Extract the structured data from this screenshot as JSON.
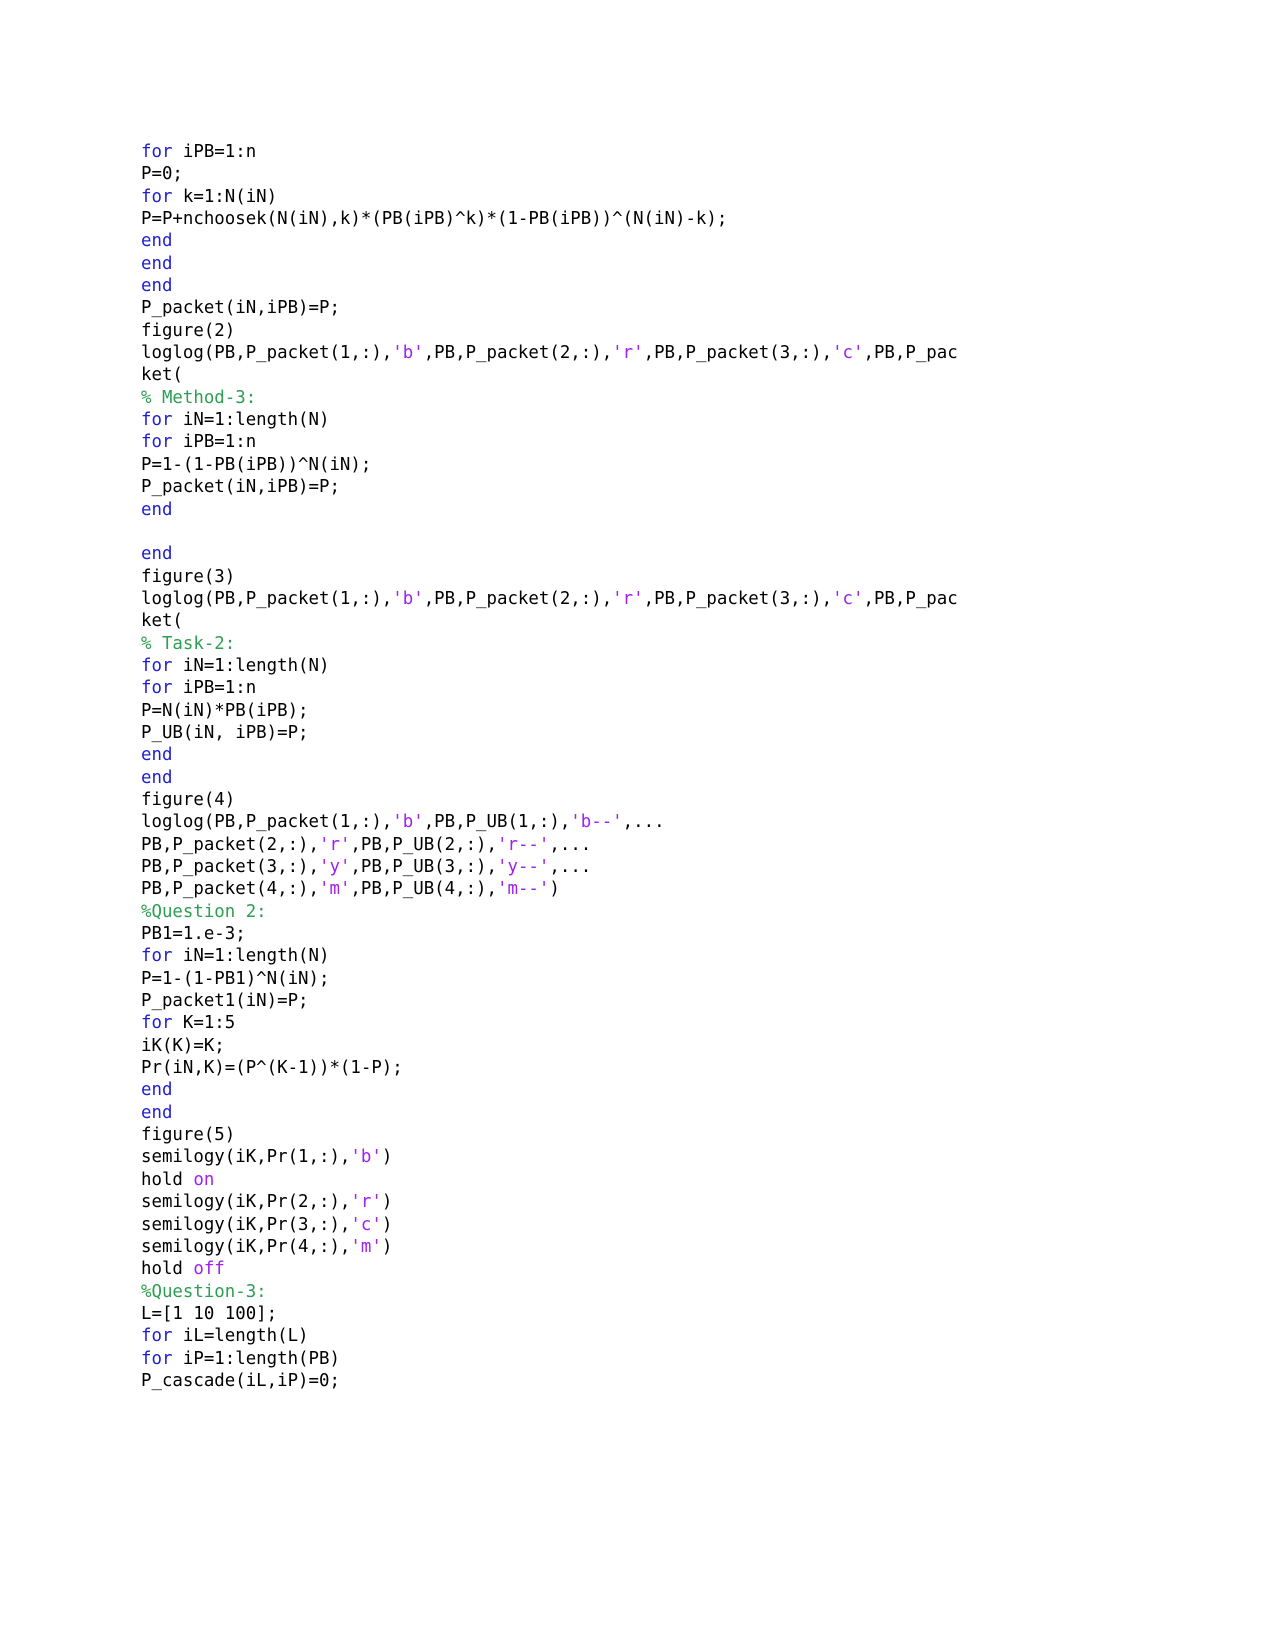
{
  "document": {
    "type": "code-listing",
    "language": "MATLAB",
    "background_color": "#ffffff",
    "colors": {
      "plain": "#000000",
      "keyword": "#2020d0",
      "comment": "#2e9e52",
      "string": "#a020f0"
    }
  },
  "code": {
    "lines": [
      {
        "id": 1,
        "tokens": [
          {
            "t": "for",
            "c": "keyword"
          },
          {
            "t": " iPB=1:n",
            "c": "plain"
          }
        ]
      },
      {
        "id": 2,
        "tokens": [
          {
            "t": "P=0;",
            "c": "plain"
          }
        ]
      },
      {
        "id": 3,
        "tokens": [
          {
            "t": "for",
            "c": "keyword"
          },
          {
            "t": " k=1:N(iN)",
            "c": "plain"
          }
        ]
      },
      {
        "id": 4,
        "tokens": [
          {
            "t": "P=P+nchoosek(N(iN),k)*(PB(iPB)^k)*(1-PB(iPB))^(N(iN)-k);",
            "c": "plain"
          }
        ]
      },
      {
        "id": 5,
        "tokens": [
          {
            "t": "end",
            "c": "keyword"
          }
        ]
      },
      {
        "id": 6,
        "tokens": [
          {
            "t": "end",
            "c": "keyword"
          }
        ]
      },
      {
        "id": 7,
        "tokens": [
          {
            "t": "end",
            "c": "keyword"
          }
        ]
      },
      {
        "id": 8,
        "tokens": [
          {
            "t": "P_packet(iN,iPB)=P;",
            "c": "plain"
          }
        ]
      },
      {
        "id": 9,
        "tokens": [
          {
            "t": "figure(2)",
            "c": "plain"
          }
        ]
      },
      {
        "id": 10,
        "tokens": [
          {
            "t": "loglog(PB,P_packet(1,:),",
            "c": "plain"
          },
          {
            "t": "'b'",
            "c": "string"
          },
          {
            "t": ",PB,P_packet(2,:),",
            "c": "plain"
          },
          {
            "t": "'r'",
            "c": "string"
          },
          {
            "t": ",PB,P_packet(3,:),",
            "c": "plain"
          },
          {
            "t": "'c'",
            "c": "string"
          },
          {
            "t": ",PB,P_pac",
            "c": "plain"
          }
        ]
      },
      {
        "id": 11,
        "tokens": [
          {
            "t": "ket(",
            "c": "plain"
          }
        ]
      },
      {
        "id": 12,
        "tokens": [
          {
            "t": "% Method-3:",
            "c": "comment"
          }
        ]
      },
      {
        "id": 13,
        "tokens": [
          {
            "t": "for",
            "c": "keyword"
          },
          {
            "t": " iN=1:length(N)",
            "c": "plain"
          }
        ]
      },
      {
        "id": 14,
        "tokens": [
          {
            "t": "for",
            "c": "keyword"
          },
          {
            "t": " iPB=1:n",
            "c": "plain"
          }
        ]
      },
      {
        "id": 15,
        "tokens": [
          {
            "t": "P=1-(1-PB(iPB))^N(iN);",
            "c": "plain"
          }
        ]
      },
      {
        "id": 16,
        "tokens": [
          {
            "t": "P_packet(iN,iPB)=P;",
            "c": "plain"
          }
        ]
      },
      {
        "id": 17,
        "tokens": [
          {
            "t": "end",
            "c": "keyword"
          }
        ]
      },
      {
        "id": 18,
        "tokens": [
          {
            "t": "",
            "c": "plain"
          }
        ]
      },
      {
        "id": 19,
        "tokens": [
          {
            "t": "end",
            "c": "keyword"
          }
        ]
      },
      {
        "id": 20,
        "tokens": [
          {
            "t": "figure(3)",
            "c": "plain"
          }
        ]
      },
      {
        "id": 21,
        "tokens": [
          {
            "t": "loglog(PB,P_packet(1,:),",
            "c": "plain"
          },
          {
            "t": "'b'",
            "c": "string"
          },
          {
            "t": ",PB,P_packet(2,:),",
            "c": "plain"
          },
          {
            "t": "'r'",
            "c": "string"
          },
          {
            "t": ",PB,P_packet(3,:),",
            "c": "plain"
          },
          {
            "t": "'c'",
            "c": "string"
          },
          {
            "t": ",PB,P_pac",
            "c": "plain"
          }
        ]
      },
      {
        "id": 22,
        "tokens": [
          {
            "t": "ket(",
            "c": "plain"
          }
        ]
      },
      {
        "id": 23,
        "tokens": [
          {
            "t": "% Task-2:",
            "c": "comment"
          }
        ]
      },
      {
        "id": 24,
        "tokens": [
          {
            "t": "for",
            "c": "keyword"
          },
          {
            "t": " iN=1:length(N)",
            "c": "plain"
          }
        ]
      },
      {
        "id": 25,
        "tokens": [
          {
            "t": "for",
            "c": "keyword"
          },
          {
            "t": " iPB=1:n",
            "c": "plain"
          }
        ]
      },
      {
        "id": 26,
        "tokens": [
          {
            "t": "P=N(iN)*PB(iPB);",
            "c": "plain"
          }
        ]
      },
      {
        "id": 27,
        "tokens": [
          {
            "t": "P_UB(iN, iPB)=P;",
            "c": "plain"
          }
        ]
      },
      {
        "id": 28,
        "tokens": [
          {
            "t": "end",
            "c": "keyword"
          }
        ]
      },
      {
        "id": 29,
        "tokens": [
          {
            "t": "end",
            "c": "keyword"
          }
        ]
      },
      {
        "id": 30,
        "tokens": [
          {
            "t": "figure(4)",
            "c": "plain"
          }
        ]
      },
      {
        "id": 31,
        "tokens": [
          {
            "t": "loglog(PB,P_packet(1,:),",
            "c": "plain"
          },
          {
            "t": "'b'",
            "c": "string"
          },
          {
            "t": ",PB,P_UB(1,:),",
            "c": "plain"
          },
          {
            "t": "'b--'",
            "c": "string"
          },
          {
            "t": ",...",
            "c": "plain"
          }
        ]
      },
      {
        "id": 32,
        "tokens": [
          {
            "t": "PB,P_packet(2,:),",
            "c": "plain"
          },
          {
            "t": "'r'",
            "c": "string"
          },
          {
            "t": ",PB,P_UB(2,:),",
            "c": "plain"
          },
          {
            "t": "'r--'",
            "c": "string"
          },
          {
            "t": ",...",
            "c": "plain"
          }
        ]
      },
      {
        "id": 33,
        "tokens": [
          {
            "t": "PB,P_packet(3,:),",
            "c": "plain"
          },
          {
            "t": "'y'",
            "c": "string"
          },
          {
            "t": ",PB,P_UB(3,:),",
            "c": "plain"
          },
          {
            "t": "'y--'",
            "c": "string"
          },
          {
            "t": ",...",
            "c": "plain"
          }
        ]
      },
      {
        "id": 34,
        "tokens": [
          {
            "t": "PB,P_packet(4,:),",
            "c": "plain"
          },
          {
            "t": "'m'",
            "c": "string"
          },
          {
            "t": ",PB,P_UB(4,:),",
            "c": "plain"
          },
          {
            "t": "'m--'",
            "c": "string"
          },
          {
            "t": ")",
            "c": "plain"
          }
        ]
      },
      {
        "id": 35,
        "tokens": [
          {
            "t": "%Question 2:",
            "c": "comment"
          }
        ]
      },
      {
        "id": 36,
        "tokens": [
          {
            "t": "PB1=1.e-3;",
            "c": "plain"
          }
        ]
      },
      {
        "id": 37,
        "tokens": [
          {
            "t": "for",
            "c": "keyword"
          },
          {
            "t": " iN=1:length(N)",
            "c": "plain"
          }
        ]
      },
      {
        "id": 38,
        "tokens": [
          {
            "t": "P=1-(1-PB1)^N(iN);",
            "c": "plain"
          }
        ]
      },
      {
        "id": 39,
        "tokens": [
          {
            "t": "P_packet1(iN)=P;",
            "c": "plain"
          }
        ]
      },
      {
        "id": 40,
        "tokens": [
          {
            "t": "for",
            "c": "keyword"
          },
          {
            "t": " K=1:5",
            "c": "plain"
          }
        ]
      },
      {
        "id": 41,
        "tokens": [
          {
            "t": "iK(K)=K;",
            "c": "plain"
          }
        ]
      },
      {
        "id": 42,
        "tokens": [
          {
            "t": "Pr(iN,K)=(P^(K-1))*(1-P);",
            "c": "plain"
          }
        ]
      },
      {
        "id": 43,
        "tokens": [
          {
            "t": "end",
            "c": "keyword"
          }
        ]
      },
      {
        "id": 44,
        "tokens": [
          {
            "t": "end",
            "c": "keyword"
          }
        ]
      },
      {
        "id": 45,
        "tokens": [
          {
            "t": "figure(5)",
            "c": "plain"
          }
        ]
      },
      {
        "id": 46,
        "tokens": [
          {
            "t": "semilogy(iK,Pr(1,:),",
            "c": "plain"
          },
          {
            "t": "'b'",
            "c": "string"
          },
          {
            "t": ")",
            "c": "plain"
          }
        ]
      },
      {
        "id": 47,
        "tokens": [
          {
            "t": "hold ",
            "c": "plain"
          },
          {
            "t": "on",
            "c": "string"
          }
        ]
      },
      {
        "id": 48,
        "tokens": [
          {
            "t": "semilogy(iK,Pr(2,:),",
            "c": "plain"
          },
          {
            "t": "'r'",
            "c": "string"
          },
          {
            "t": ")",
            "c": "plain"
          }
        ]
      },
      {
        "id": 49,
        "tokens": [
          {
            "t": "semilogy(iK,Pr(3,:),",
            "c": "plain"
          },
          {
            "t": "'c'",
            "c": "string"
          },
          {
            "t": ")",
            "c": "plain"
          }
        ]
      },
      {
        "id": 50,
        "tokens": [
          {
            "t": "semilogy(iK,Pr(4,:),",
            "c": "plain"
          },
          {
            "t": "'m'",
            "c": "string"
          },
          {
            "t": ")",
            "c": "plain"
          }
        ]
      },
      {
        "id": 51,
        "tokens": [
          {
            "t": "hold ",
            "c": "plain"
          },
          {
            "t": "off",
            "c": "string"
          }
        ]
      },
      {
        "id": 52,
        "tokens": [
          {
            "t": "%Question-3:",
            "c": "comment"
          }
        ]
      },
      {
        "id": 53,
        "tokens": [
          {
            "t": "L=[1 10 100];",
            "c": "plain"
          }
        ]
      },
      {
        "id": 54,
        "tokens": [
          {
            "t": "for",
            "c": "keyword"
          },
          {
            "t": " iL=length(L)",
            "c": "plain"
          }
        ]
      },
      {
        "id": 55,
        "tokens": [
          {
            "t": "for",
            "c": "keyword"
          },
          {
            "t": " iP=1:length(PB)",
            "c": "plain"
          }
        ]
      },
      {
        "id": 56,
        "tokens": [
          {
            "t": "P_cascade(iL,iP)=0;",
            "c": "plain"
          }
        ]
      }
    ]
  }
}
